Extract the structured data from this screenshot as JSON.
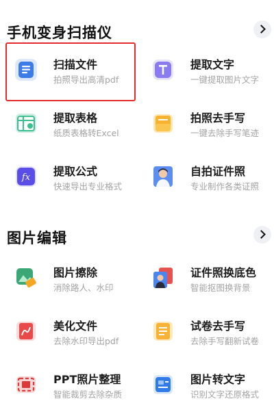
{
  "sections": [
    {
      "title": "手机变身扫描仪",
      "more_icon": "chevron-right-icon",
      "tools": [
        {
          "label": "扫描文件",
          "desc": "拍照导出高清pdf",
          "icon": "scan-document-icon",
          "highlighted": true
        },
        {
          "label": "提取文字",
          "desc": "一键提取图片文字",
          "icon": "text-extract-icon"
        },
        {
          "label": "提取表格",
          "desc": "纸质表格转Excel",
          "icon": "table-extract-icon"
        },
        {
          "label": "拍照去手写",
          "desc": "一键去除手写笔迹",
          "icon": "remove-handwriting-icon"
        },
        {
          "label": "提取公式",
          "desc": "快速导出专业格式",
          "icon": "formula-icon"
        },
        {
          "label": "自拍证件照",
          "desc": "专业制作各类证照",
          "icon": "id-photo-icon"
        }
      ]
    },
    {
      "title": "图片编辑",
      "more_icon": "chevron-right-icon",
      "tools": [
        {
          "label": "图片擦除",
          "desc": "消除路人、水印",
          "icon": "image-erase-icon"
        },
        {
          "label": "证件照换底色",
          "desc": "智能抠图换背景",
          "icon": "change-background-icon"
        },
        {
          "label": "美化文件",
          "desc": "去除水印导出pdf",
          "icon": "beautify-file-icon"
        },
        {
          "label": "试卷去手写",
          "desc": "去除手写翻新试卷",
          "icon": "exam-paper-icon"
        },
        {
          "label": "PPT照片整理",
          "desc": "智能裁剪去除杂质",
          "icon": "ppt-photo-icon"
        },
        {
          "label": "图片转文字",
          "desc": "识别文字还原格式",
          "icon": "image-to-text-icon"
        }
      ]
    }
  ],
  "colors": {
    "highlight_border": "#e5292b",
    "title": "#111111",
    "desc": "#a3a3a3"
  }
}
